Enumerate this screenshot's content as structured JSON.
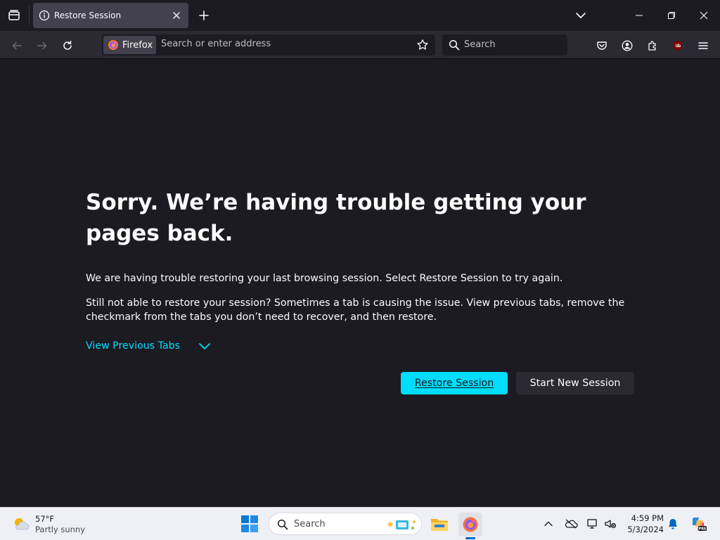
{
  "browser": {
    "tab": {
      "title": "Restore Session"
    },
    "identity_label": "Firefox",
    "url": {
      "value": "",
      "placeholder": "Search or enter address"
    },
    "search": {
      "value": "",
      "placeholder": "Search"
    },
    "icons": {
      "tablist": "firefox-view-icon",
      "tab_info": "info-icon",
      "tab_close": "close-icon",
      "new_tab": "plus-icon",
      "all_tabs": "chevron-down-icon",
      "minimize": "minimize-icon",
      "restore": "restore-window-icon",
      "close": "close-window-icon",
      "back": "back-arrow-icon",
      "forward": "forward-arrow-icon",
      "reload": "reload-icon",
      "bookmark": "star-icon",
      "pocket": "pocket-icon",
      "account": "account-icon",
      "extensions": "extensions-icon",
      "ublock": "ublock-origin-icon",
      "menu": "hamburger-menu-icon"
    }
  },
  "page": {
    "title": "Sorry. We’re having trouble getting your pages back.",
    "paragraph1": "We are having trouble restoring your last browsing session. Select Restore Session to try again.",
    "paragraph2": "Still not able to restore your session? Sometimes a tab is causing the issue. View previous tabs, remove the checkmark from the tabs you don’t need to recover, and then restore.",
    "view_previous_tabs": "View Previous Tabs",
    "restore_button": "Restore Session",
    "new_session_button": "Start New Session"
  },
  "taskbar": {
    "weather": {
      "temp": "57°F",
      "condition": "Partly sunny"
    },
    "search_label": "Search",
    "clock": {
      "time": "4:59 PM",
      "date": "5/3/2024"
    },
    "apps": [
      "start-icon",
      "file-explorer-icon",
      "firefox-icon"
    ],
    "tray": [
      "show-hidden-icons-icon",
      "onedrive-offline-icon",
      "network-icon",
      "volume-muted-icon",
      "notification-bell-icon",
      "copilot-icon"
    ]
  },
  "colors": {
    "page_bg": "#1c1b22",
    "toolbar_bg": "#2b2a33",
    "accent": "#00ddff",
    "text": "#fbfbfe",
    "taskbar_bg": "#eef0f5"
  }
}
